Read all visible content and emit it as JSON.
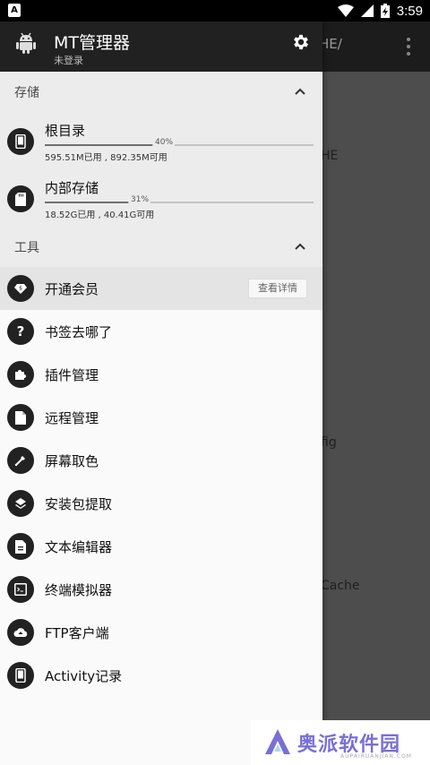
{
  "status_bar": {
    "notification_glyph": "A",
    "time": "3:59"
  },
  "background": {
    "path_fragment": "HE/",
    "items": [
      "HE",
      "fig",
      "Cache"
    ]
  },
  "header": {
    "title": "MT管理器",
    "subtitle": "未登录"
  },
  "storage_section": {
    "title": "存储",
    "items": [
      {
        "name": "根目录",
        "percent": "40%",
        "usage_fraction": 0.4,
        "detail": "595.51M已用 , 892.35M可用",
        "icon": "phone-icon"
      },
      {
        "name": "内部存储",
        "percent": "31%",
        "usage_fraction": 0.31,
        "detail": "18.52G已用 , 40.41G可用",
        "icon": "sd-card-icon"
      }
    ]
  },
  "tools_section": {
    "title": "工具",
    "items": [
      {
        "label": "开通会员",
        "icon": "vip-diamond-icon",
        "button": "查看详情"
      },
      {
        "label": "书签去哪了",
        "icon": "question-icon"
      },
      {
        "label": "插件管理",
        "icon": "puzzle-icon"
      },
      {
        "label": "远程管理",
        "icon": "file-icon"
      },
      {
        "label": "屏幕取色",
        "icon": "eyedropper-icon"
      },
      {
        "label": "安装包提取",
        "icon": "layers-icon"
      },
      {
        "label": "文本编辑器",
        "icon": "document-icon"
      },
      {
        "label": "终端模拟器",
        "icon": "terminal-icon"
      },
      {
        "label": "FTP客户端",
        "icon": "cloud-icon"
      },
      {
        "label": "Activity记录",
        "icon": "phone-icon"
      }
    ]
  },
  "watermark": {
    "text": "奥派软件园",
    "subtext": "AUPAIRUANJIAN.COM"
  },
  "colors": {
    "header_bg": "#212121",
    "drawer_bg": "#fafafa",
    "section_bg": "#ececec",
    "icon_circle": "#222222",
    "watermark": "#7a6fd6"
  }
}
